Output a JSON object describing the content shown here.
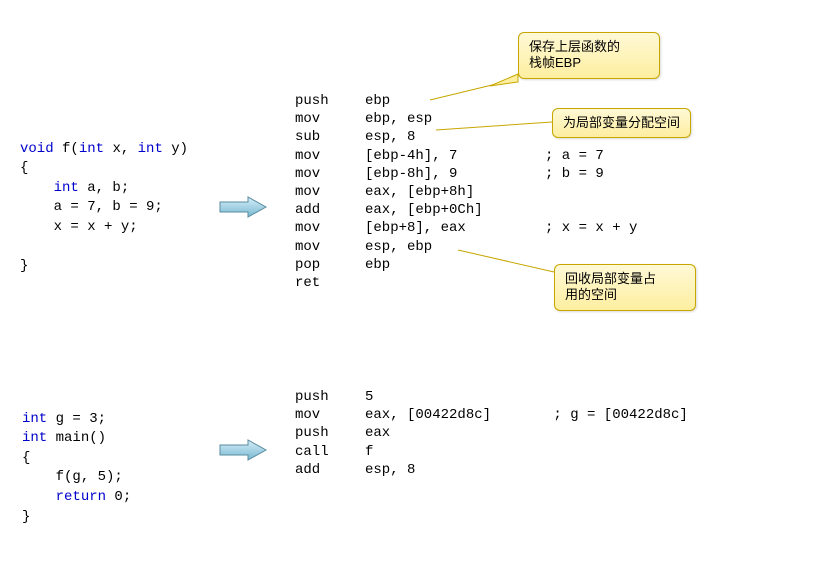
{
  "c_code_f": {
    "l1_kw1": "void",
    "l1_fn": " f(",
    "l1_kw2": "int",
    "l1_p1": " x, ",
    "l1_kw3": "int",
    "l1_p2": " y)",
    "l2": "{",
    "l3_kw": "int",
    "l3_rest": " a, b;",
    "l4": "a = 7, b = 9;",
    "l5": "x = x + y;",
    "l6": "",
    "l7": "}"
  },
  "c_code_main": {
    "l1_kw": "int",
    "l1_rest": " g = 3;",
    "l2_kw": "int",
    "l2_rest": " main()",
    "l3": "{",
    "l4": "f(g, 5);",
    "l5_kw": "return",
    "l5_rest": " 0;",
    "l6": "}"
  },
  "asm_f": [
    {
      "op": "push",
      "arg": "ebp",
      "cmt": ""
    },
    {
      "op": "mov",
      "arg": "ebp, esp",
      "cmt": ""
    },
    {
      "op": "sub",
      "arg": "esp, 8",
      "cmt": ""
    },
    {
      "op": "mov",
      "arg": "[ebp-4h], 7",
      "cmt": "; a = 7"
    },
    {
      "op": "mov",
      "arg": "[ebp-8h], 9",
      "cmt": "; b = 9"
    },
    {
      "op": "mov",
      "arg": "eax, [ebp+8h]",
      "cmt": ""
    },
    {
      "op": "add",
      "arg": "eax, [ebp+0Ch]",
      "cmt": ""
    },
    {
      "op": "mov",
      "arg": "[ebp+8], eax",
      "cmt": "; x = x + y"
    },
    {
      "op": "mov",
      "arg": "esp, ebp",
      "cmt": ""
    },
    {
      "op": "pop",
      "arg": "ebp",
      "cmt": ""
    },
    {
      "op": "ret",
      "arg": "",
      "cmt": ""
    }
  ],
  "asm_main": [
    {
      "op": "push",
      "arg": "5",
      "cmt": ""
    },
    {
      "op": "mov",
      "arg": "eax, [00422d8c]",
      "cmt": " ; g = [00422d8c]"
    },
    {
      "op": "push",
      "arg": "eax",
      "cmt": ""
    },
    {
      "op": "call",
      "arg": "f",
      "cmt": ""
    },
    {
      "op": "add",
      "arg": "esp, 8",
      "cmt": ""
    }
  ],
  "callouts": {
    "c1": "保存上层函数的\n栈帧EBP",
    "c2": "为局部变量分配空间",
    "c3": "回收局部变量占\n用的空间"
  }
}
